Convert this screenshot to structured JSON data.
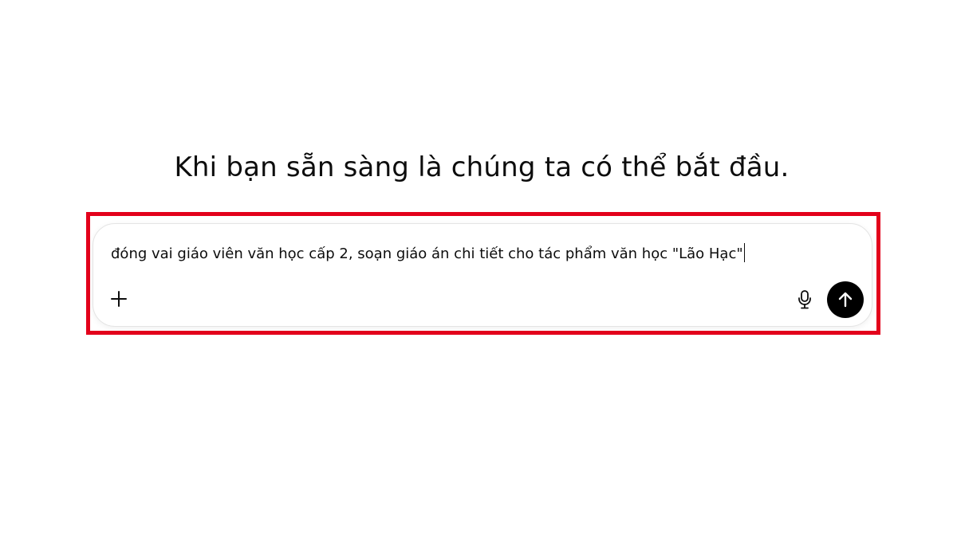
{
  "heading": {
    "text": "Khi bạn sẵn sàng là chúng ta có thể bắt đầu."
  },
  "composer": {
    "input_value": "đóng vai giáo viên văn học cấp 2, soạn giáo án chi tiết cho tác phẩm văn học \"Lão Hạc\"",
    "add_icon": "plus-icon",
    "mic_icon": "microphone-icon",
    "send_icon": "arrow-up-icon"
  },
  "colors": {
    "highlight_border": "#e3001b",
    "send_button_bg": "#000000",
    "text": "#0d0d0d"
  }
}
